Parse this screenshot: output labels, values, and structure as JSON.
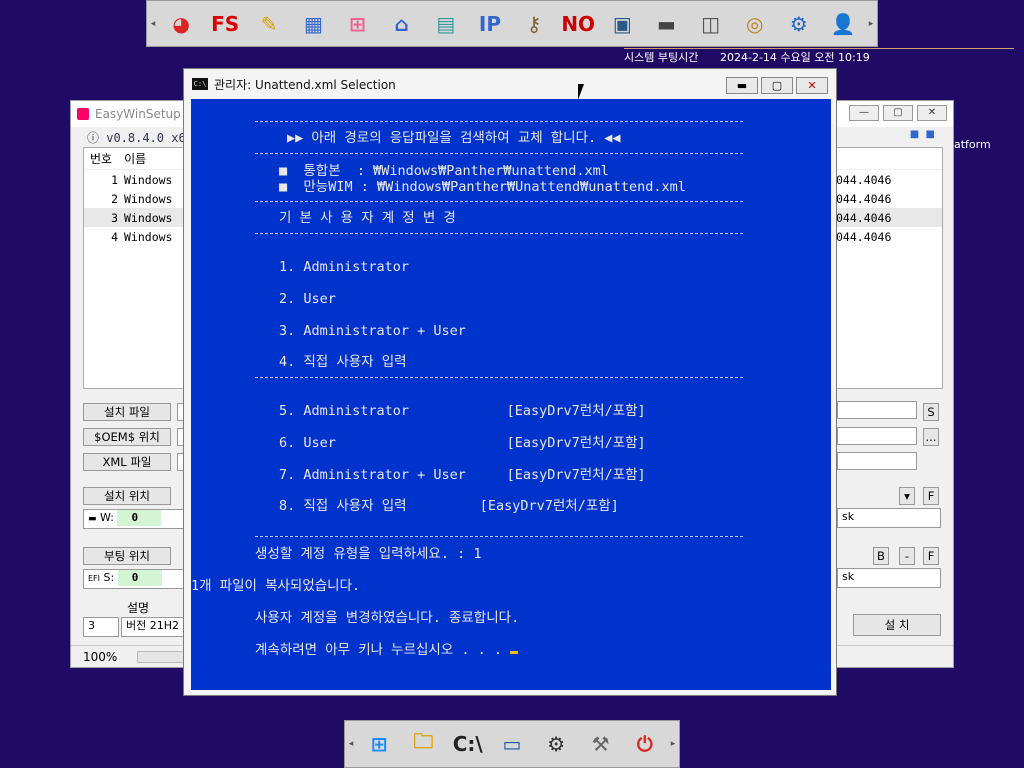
{
  "topdock": {
    "icons": [
      {
        "name": "partition-icon",
        "glyph": "◕",
        "color": "#d22"
      },
      {
        "name": "fs-icon",
        "glyph": "FS",
        "color": "#d00"
      },
      {
        "name": "wizard-icon",
        "glyph": "✎",
        "color": "#d8a000"
      },
      {
        "name": "tiles-icon",
        "glyph": "▦",
        "color": "#3366cc"
      },
      {
        "name": "windows-tile-icon",
        "glyph": "⊞",
        "color": "#f06090"
      },
      {
        "name": "network-icon",
        "glyph": "⌂",
        "color": "#3366cc"
      },
      {
        "name": "book-icon",
        "glyph": "▤",
        "color": "#339999"
      },
      {
        "name": "ip-icon",
        "glyph": "IP",
        "color": "#3366cc"
      },
      {
        "name": "keys-icon",
        "glyph": "⚷",
        "color": "#806030"
      },
      {
        "name": "no-tool-icon",
        "glyph": "NO",
        "color": "#cc0000"
      },
      {
        "name": "user-photo-icon",
        "glyph": "▣",
        "color": "#2a5a8a"
      },
      {
        "name": "drive-icon",
        "glyph": "▬",
        "color": "#444"
      },
      {
        "name": "floppy-icon",
        "glyph": "◫",
        "color": "#555"
      },
      {
        "name": "disc-box-icon",
        "glyph": "◎",
        "color": "#c08020"
      },
      {
        "name": "settings-gears-icon",
        "glyph": "⚙",
        "color": "#2266cc"
      },
      {
        "name": "add-user-icon",
        "glyph": "👤",
        "color": "#111"
      }
    ]
  },
  "sysinfo": {
    "label": "시스템 부팅시간",
    "datetime": "2024-2-14 수요일 오전 10:19"
  },
  "easywinsetup": {
    "title": "EasyWinSetup",
    "version": "ⓘ v0.8.4.0 x64",
    "col_no": "번호",
    "col_name": "이름",
    "rows": [
      {
        "no": "1",
        "name": "Windows",
        "build": "044.4046"
      },
      {
        "no": "2",
        "name": "Windows",
        "build": "044.4046"
      },
      {
        "no": "3",
        "name": "Windows",
        "build": "044.4046"
      },
      {
        "no": "4",
        "name": "Windows",
        "build": "044.4046"
      }
    ],
    "side_text": "atform",
    "btn_install_file": "설치 파일",
    "btn_oem": "$OEM$ 위치",
    "btn_xml": "XML 파일",
    "btn_install_loc": "설치 위치",
    "btn_boot_loc": "부팅 위치",
    "drive_w_label": "W:",
    "drive_w_value": "0",
    "drive_s_label": "S:",
    "drive_s_value": "0",
    "efi_label": "EFI",
    "desc_label": "설명",
    "desc_index": "3",
    "desc_value": "버전 21H2",
    "btn_s": "S",
    "btn_dots": "...",
    "btn_dropdown": "▾",
    "btn_f1": "F",
    "btn_b": "B",
    "btn_minus": "-",
    "btn_f2": "F",
    "disk_text1": "sk",
    "disk_text2": "sk",
    "btn_install": "설 치",
    "zoom": "100%"
  },
  "console": {
    "title": "관리자:  Unattend.xml Selection",
    "icon_text": "C:\\",
    "rule": "-----------------------------------------------------------",
    "header": "▶▶ 아래 경로의 응답파일을 검색하여 교체 합니다. ◀◀",
    "path1": "■  통합본  : ₩Windows₩Panther₩unattend.xml",
    "path2": "■  만능WIM : ₩Windows₩Panther₩Unattend₩unattend.xml",
    "section": "기 본 사 용 자 계 정 변 경",
    "opt1": "1. Administrator",
    "opt2": "2. User",
    "opt3": "3. Administrator + User",
    "opt4": "4. 직접 사용자 입력",
    "opt5": "5. Administrator            [EasyDrv7런처/포함]",
    "opt6": "6. User                     [EasyDrv7런처/포함]",
    "opt7": "7. Administrator + User     [EasyDrv7런처/포함]",
    "opt8": "8. 직접 사용자 입력         [EasyDrv7런처/포함]",
    "prompt": "생성할 계정 유형을 입력하세요. : 1",
    "copied": "1개 파일이 복사되었습니다.",
    "changed": "사용자 계정을 변경하였습니다. 종료합니다.",
    "continue": "계속하려면 아무 키나 누르십시오 . . . "
  },
  "taskbar": {
    "icons": [
      {
        "name": "windows-start-icon",
        "glyph": "⊞",
        "color": "#1a8cff"
      },
      {
        "name": "folder-search-icon",
        "glyph": "🗀",
        "color": "#e0a000"
      },
      {
        "name": "cmd-icon",
        "glyph": "C:\\",
        "color": "#222"
      },
      {
        "name": "monitor-icon",
        "glyph": "▭",
        "color": "#1a5aa0"
      },
      {
        "name": "settings-icon",
        "glyph": "⚙",
        "color": "#333"
      },
      {
        "name": "hammer-icon",
        "glyph": "⚒",
        "color": "#666"
      },
      {
        "name": "power-icon",
        "glyph": "⏻",
        "color": "#d22"
      }
    ]
  }
}
